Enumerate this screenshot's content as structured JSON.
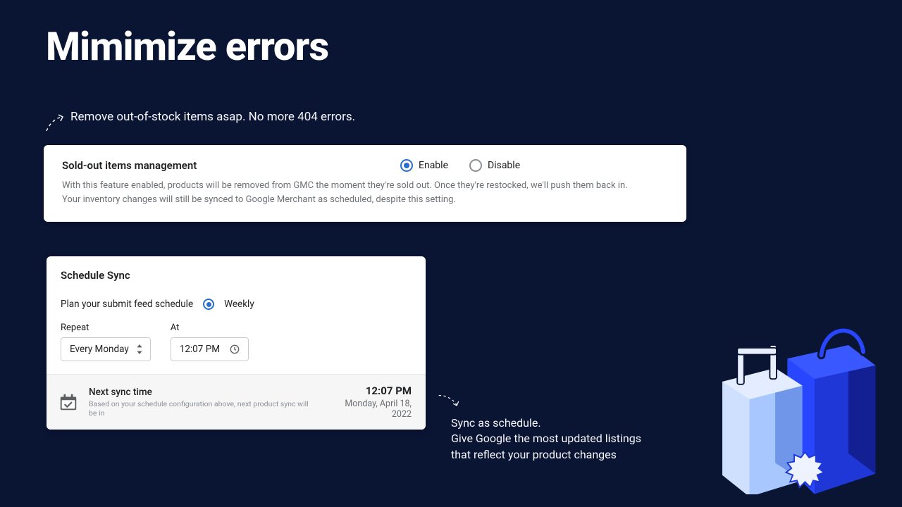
{
  "colors": {
    "accent": "#2c6ecb",
    "bg": "#0a1433"
  },
  "page": {
    "title": "Mimimize errors"
  },
  "annotation1": {
    "text": "Remove out-of-stock items asap. No more 404 errors."
  },
  "card_soldout": {
    "title": "Sold-out items management",
    "options": {
      "enable": "Enable",
      "disable": "Disable",
      "selected": "enable"
    },
    "desc_line1": "With this feature enabled, products will be removed from GMC the moment they're sold out. Once they're restocked, we'll push them back in.",
    "desc_line2": "Your inventory changes will still be synced to Google Merchant as scheduled, despite this setting."
  },
  "card_schedule": {
    "title": "Schedule Sync",
    "plan_label": "Plan your submit feed schedule",
    "frequency": {
      "label": "Weekly",
      "selected": true
    },
    "repeat_field": {
      "label": "Repeat",
      "value": "Every Monday"
    },
    "at_field": {
      "label": "At",
      "value": "12:07 PM"
    },
    "next_sync": {
      "title": "Next sync time",
      "subtitle": "Based on your schedule configuration above, next product sync will be in",
      "time": "12:07 PM",
      "date": "Monday, April 18, 2022"
    }
  },
  "annotation2": {
    "line1": "Sync as schedule.",
    "line2": "Give Google the most updated listings",
    "line3": "that reflect your product changes"
  }
}
